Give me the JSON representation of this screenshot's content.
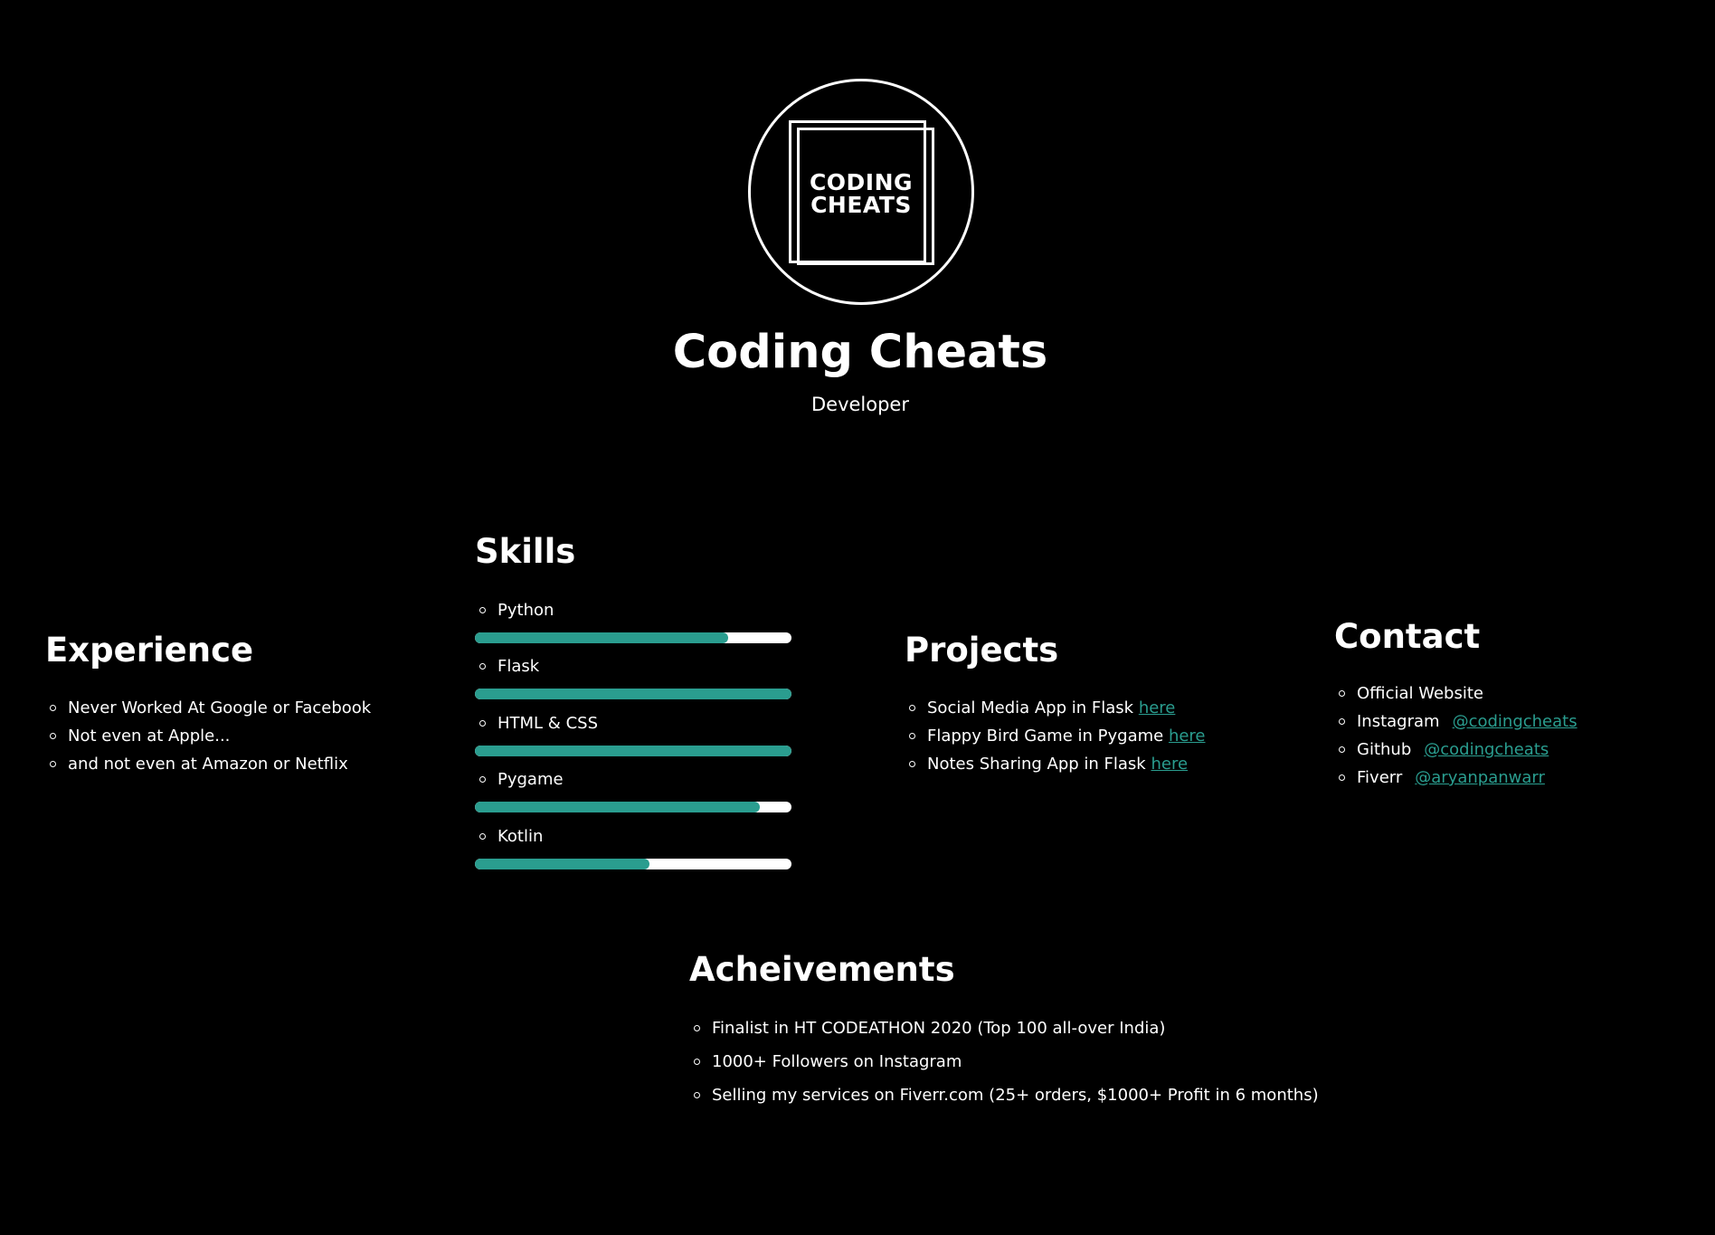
{
  "header": {
    "logo_line1": "CODING",
    "logo_line2": "CHEATS",
    "title": "Coding Cheats",
    "subtitle": "Developer"
  },
  "experience": {
    "heading": "Experience",
    "items": [
      "Never Worked At Google or Facebook",
      "Not even at Apple...",
      "and not even at Amazon or Netflix"
    ]
  },
  "skills": {
    "heading": "Skills",
    "items": [
      {
        "label": "Python",
        "level": 0.8
      },
      {
        "label": "Flask",
        "level": 1.0
      },
      {
        "label": "HTML & CSS",
        "level": 1.0
      },
      {
        "label": "Pygame",
        "level": 0.9
      },
      {
        "label": "Kotlin",
        "level": 0.55
      }
    ]
  },
  "projects": {
    "heading": "Projects",
    "link_text": "here",
    "items": [
      "Social Media App in Flask",
      "Flappy Bird Game in Pygame",
      "Notes Sharing App in Flask"
    ]
  },
  "contact": {
    "heading": "Contact",
    "items": [
      {
        "label": "Official Website",
        "link": ""
      },
      {
        "label": "Instagram",
        "link": "@codingcheats"
      },
      {
        "label": "Github",
        "link": "@codingcheats"
      },
      {
        "label": "Fiverr",
        "link": "@aryanpanwarr"
      }
    ]
  },
  "achievements": {
    "heading": "Acheivements",
    "items": [
      "Finalist in HT CODEATHON 2020 (Top 100 all-over India)",
      "1000+ Followers on Instagram",
      "Selling my services on Fiverr.com (25+ orders, $1000+ Profit in 6 months)"
    ]
  },
  "colors": {
    "background": "#000000",
    "text": "#ffffff",
    "accent": "#2a9d8f",
    "bar_track": "#ffffff"
  }
}
